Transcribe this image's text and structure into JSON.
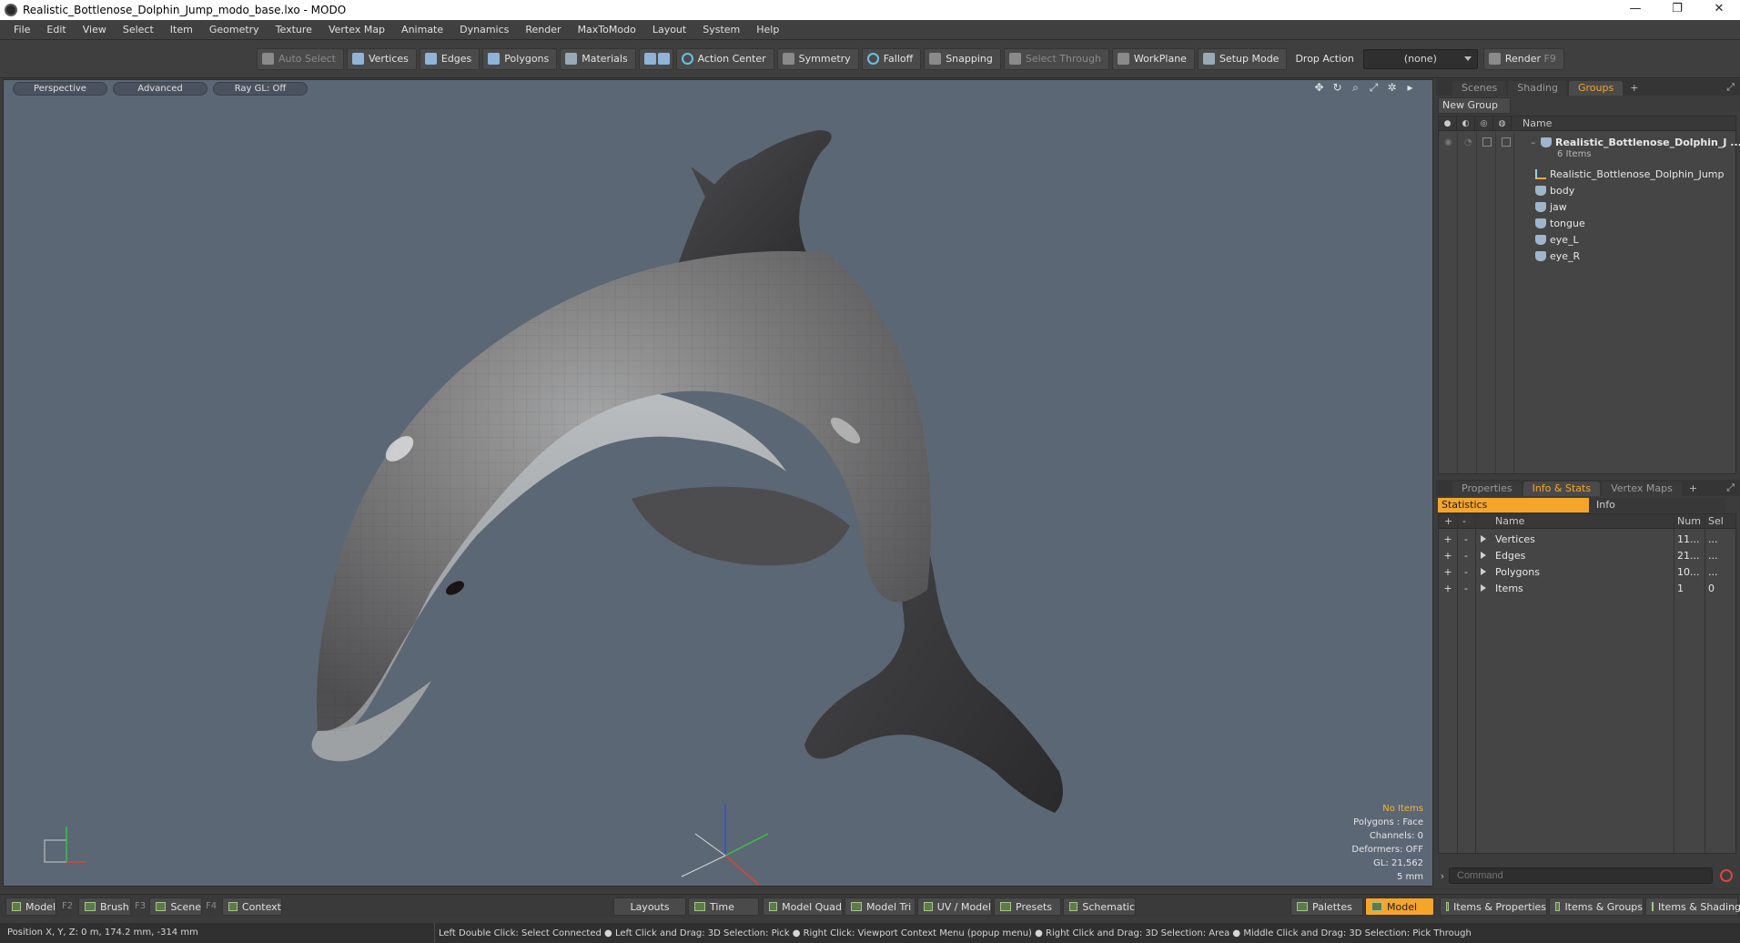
{
  "window": {
    "title": "Realistic_Bottlenose_Dolphin_Jump_modo_base.lxo - MODO",
    "controls": [
      "—",
      "❐",
      "✕"
    ]
  },
  "menu": [
    "File",
    "Edit",
    "View",
    "Select",
    "Item",
    "Geometry",
    "Texture",
    "Vertex Map",
    "Animate",
    "Dynamics",
    "Render",
    "MaxToModo",
    "Layout",
    "System",
    "Help"
  ],
  "toolbar": {
    "auto_select": "Auto Select",
    "vertices": "Vertices",
    "edges": "Edges",
    "polygons": "Polygons",
    "materials": "Materials",
    "action_center": "Action Center",
    "symmetry": "Symmetry",
    "falloff": "Falloff",
    "snapping": "Snapping",
    "select_through": "Select Through",
    "workplane": "WorkPlane",
    "setup_mode": "Setup Mode",
    "drop_action_label": "Drop Action",
    "drop_action_value": "(none)",
    "render": "Render",
    "render_key": "F9"
  },
  "viewport": {
    "view_mode": "Perspective",
    "shading": "Advanced",
    "raygl": "Ray GL: Off",
    "stats": {
      "selection": "No Items",
      "polygons": "Polygons : Face",
      "channels": "Channels: 0",
      "deformers": "Deformers: OFF",
      "gl": "GL: 21,562",
      "scale": "5 mm"
    },
    "colors": {
      "background": "#5c6775",
      "body": "#6f6e6f",
      "belly": "#b9bcbd",
      "fin": "#3b3b3d"
    }
  },
  "groups_panel": {
    "tabs": [
      "Scenes",
      "Shading",
      "Groups"
    ],
    "active_tab": "Groups",
    "new_group": "New Group",
    "name_header": "Name",
    "root": {
      "name": "Realistic_Bottlenose_Dolphin_J ...",
      "count": "6 Items"
    },
    "items": [
      {
        "name": "Realistic_Bottlenose_Dolphin_Jump",
        "icon": "locator-icon"
      },
      {
        "name": "body",
        "icon": "mesh-icon"
      },
      {
        "name": "jaw",
        "icon": "mesh-icon"
      },
      {
        "name": "tongue",
        "icon": "mesh-icon"
      },
      {
        "name": "eye_L",
        "icon": "mesh-icon"
      },
      {
        "name": "eye_R",
        "icon": "mesh-icon"
      }
    ]
  },
  "stats_panel": {
    "tabs": [
      "Properties",
      "Info & Stats",
      "Vertex Maps"
    ],
    "active_tab": "Info & Stats",
    "subtabs": [
      "Statistics",
      "Info"
    ],
    "headers": {
      "name": "Name",
      "num": "Num",
      "sel": "Sel"
    },
    "rows": [
      {
        "name": "Vertices",
        "num": "11...",
        "sel": "..."
      },
      {
        "name": "Edges",
        "num": "21...",
        "sel": "..."
      },
      {
        "name": "Polygons",
        "num": "10...",
        "sel": "..."
      },
      {
        "name": "Items",
        "num": "1",
        "sel": "0"
      }
    ]
  },
  "command": {
    "placeholder": "Command"
  },
  "bottombar": {
    "model": "Model",
    "model_key": "F2",
    "brush": "Brush",
    "brush_key": "F3",
    "scene": "Scene",
    "scene_key": "F4",
    "context": "Context",
    "layouts": "Layouts",
    "time": "Time",
    "model_quad": "Model Quad",
    "model_tri": "Model Tri",
    "uv_model": "UV / Model",
    "presets": "Presets",
    "schematic": "Schematic",
    "palettes": "Palettes",
    "model_active": "Model",
    "items_properties": "Items & Properties",
    "items_groups": "Items & Groups",
    "items_shading": "Items & Shading"
  },
  "status": {
    "position": "Position X, Y, Z:   0 m, 174.2 mm, -314 mm",
    "hints": "Left Double Click: Select Connected ● Left Click and Drag: 3D Selection: Pick ● Right Click: Viewport Context Menu (popup menu) ● Right Click and Drag: 3D Selection: Area ● Middle Click and Drag: 3D Selection: Pick Through"
  }
}
